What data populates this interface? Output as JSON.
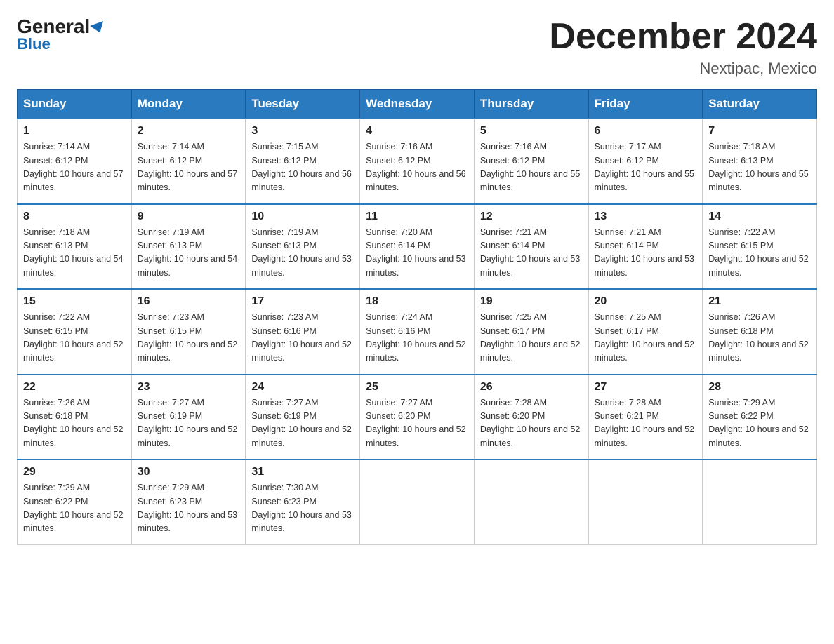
{
  "header": {
    "logo_general": "General",
    "logo_blue": "Blue",
    "month_title": "December 2024",
    "location": "Nextipac, Mexico"
  },
  "days_of_week": [
    "Sunday",
    "Monday",
    "Tuesday",
    "Wednesday",
    "Thursday",
    "Friday",
    "Saturday"
  ],
  "weeks": [
    [
      {
        "day": "1",
        "sunrise": "7:14 AM",
        "sunset": "6:12 PM",
        "daylight": "10 hours and 57 minutes."
      },
      {
        "day": "2",
        "sunrise": "7:14 AM",
        "sunset": "6:12 PM",
        "daylight": "10 hours and 57 minutes."
      },
      {
        "day": "3",
        "sunrise": "7:15 AM",
        "sunset": "6:12 PM",
        "daylight": "10 hours and 56 minutes."
      },
      {
        "day": "4",
        "sunrise": "7:16 AM",
        "sunset": "6:12 PM",
        "daylight": "10 hours and 56 minutes."
      },
      {
        "day": "5",
        "sunrise": "7:16 AM",
        "sunset": "6:12 PM",
        "daylight": "10 hours and 55 minutes."
      },
      {
        "day": "6",
        "sunrise": "7:17 AM",
        "sunset": "6:12 PM",
        "daylight": "10 hours and 55 minutes."
      },
      {
        "day": "7",
        "sunrise": "7:18 AM",
        "sunset": "6:13 PM",
        "daylight": "10 hours and 55 minutes."
      }
    ],
    [
      {
        "day": "8",
        "sunrise": "7:18 AM",
        "sunset": "6:13 PM",
        "daylight": "10 hours and 54 minutes."
      },
      {
        "day": "9",
        "sunrise": "7:19 AM",
        "sunset": "6:13 PM",
        "daylight": "10 hours and 54 minutes."
      },
      {
        "day": "10",
        "sunrise": "7:19 AM",
        "sunset": "6:13 PM",
        "daylight": "10 hours and 53 minutes."
      },
      {
        "day": "11",
        "sunrise": "7:20 AM",
        "sunset": "6:14 PM",
        "daylight": "10 hours and 53 minutes."
      },
      {
        "day": "12",
        "sunrise": "7:21 AM",
        "sunset": "6:14 PM",
        "daylight": "10 hours and 53 minutes."
      },
      {
        "day": "13",
        "sunrise": "7:21 AM",
        "sunset": "6:14 PM",
        "daylight": "10 hours and 53 minutes."
      },
      {
        "day": "14",
        "sunrise": "7:22 AM",
        "sunset": "6:15 PM",
        "daylight": "10 hours and 52 minutes."
      }
    ],
    [
      {
        "day": "15",
        "sunrise": "7:22 AM",
        "sunset": "6:15 PM",
        "daylight": "10 hours and 52 minutes."
      },
      {
        "day": "16",
        "sunrise": "7:23 AM",
        "sunset": "6:15 PM",
        "daylight": "10 hours and 52 minutes."
      },
      {
        "day": "17",
        "sunrise": "7:23 AM",
        "sunset": "6:16 PM",
        "daylight": "10 hours and 52 minutes."
      },
      {
        "day": "18",
        "sunrise": "7:24 AM",
        "sunset": "6:16 PM",
        "daylight": "10 hours and 52 minutes."
      },
      {
        "day": "19",
        "sunrise": "7:25 AM",
        "sunset": "6:17 PM",
        "daylight": "10 hours and 52 minutes."
      },
      {
        "day": "20",
        "sunrise": "7:25 AM",
        "sunset": "6:17 PM",
        "daylight": "10 hours and 52 minutes."
      },
      {
        "day": "21",
        "sunrise": "7:26 AM",
        "sunset": "6:18 PM",
        "daylight": "10 hours and 52 minutes."
      }
    ],
    [
      {
        "day": "22",
        "sunrise": "7:26 AM",
        "sunset": "6:18 PM",
        "daylight": "10 hours and 52 minutes."
      },
      {
        "day": "23",
        "sunrise": "7:27 AM",
        "sunset": "6:19 PM",
        "daylight": "10 hours and 52 minutes."
      },
      {
        "day": "24",
        "sunrise": "7:27 AM",
        "sunset": "6:19 PM",
        "daylight": "10 hours and 52 minutes."
      },
      {
        "day": "25",
        "sunrise": "7:27 AM",
        "sunset": "6:20 PM",
        "daylight": "10 hours and 52 minutes."
      },
      {
        "day": "26",
        "sunrise": "7:28 AM",
        "sunset": "6:20 PM",
        "daylight": "10 hours and 52 minutes."
      },
      {
        "day": "27",
        "sunrise": "7:28 AM",
        "sunset": "6:21 PM",
        "daylight": "10 hours and 52 minutes."
      },
      {
        "day": "28",
        "sunrise": "7:29 AM",
        "sunset": "6:22 PM",
        "daylight": "10 hours and 52 minutes."
      }
    ],
    [
      {
        "day": "29",
        "sunrise": "7:29 AM",
        "sunset": "6:22 PM",
        "daylight": "10 hours and 52 minutes."
      },
      {
        "day": "30",
        "sunrise": "7:29 AM",
        "sunset": "6:23 PM",
        "daylight": "10 hours and 53 minutes."
      },
      {
        "day": "31",
        "sunrise": "7:30 AM",
        "sunset": "6:23 PM",
        "daylight": "10 hours and 53 minutes."
      },
      null,
      null,
      null,
      null
    ]
  ],
  "labels": {
    "sunrise_prefix": "Sunrise: ",
    "sunset_prefix": "Sunset: ",
    "daylight_prefix": "Daylight: "
  }
}
